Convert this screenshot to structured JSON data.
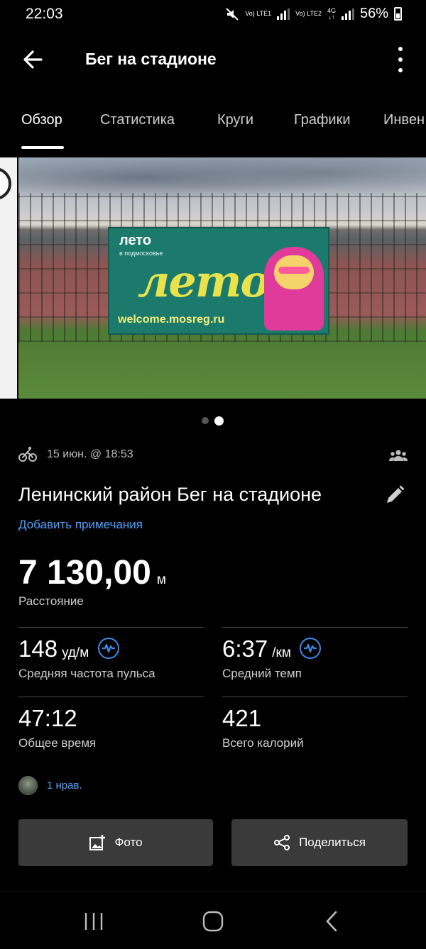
{
  "status_bar": {
    "time": "22:03",
    "network1": "Vo) LTE1",
    "network2": "Vo) LTE2",
    "network_gen": "4G",
    "battery_percent": "56%"
  },
  "app_bar": {
    "title": "Бег на стадионе"
  },
  "tabs": [
    {
      "label": "Обзор",
      "active": true
    },
    {
      "label": "Статистика",
      "active": false
    },
    {
      "label": "Круги",
      "active": false
    },
    {
      "label": "Графики",
      "active": false
    },
    {
      "label": "Инвен",
      "active": false
    }
  ],
  "photo": {
    "banner_title": "лето",
    "banner_subtitle": "в подмосковье",
    "banner_script": "лето",
    "banner_url": "welcome.mosreg.ru",
    "page_count": 2,
    "active_page": 2
  },
  "activity": {
    "date": "15 июн. @ 18:53",
    "name": "Ленинский район Бег на стадионе",
    "add_note": "Добавить примечания",
    "distance_value": "7 130,00",
    "distance_unit": "м",
    "distance_label": "Расстояние"
  },
  "stats": {
    "hr": {
      "value": "148",
      "unit": "уд/м",
      "label": "Средняя частота пульса"
    },
    "pace": {
      "value": "6:37",
      "unit": "/км",
      "label": "Средний темп"
    },
    "time": {
      "value": "47:12",
      "label": "Общее время"
    },
    "calories": {
      "value": "421",
      "label": "Всего калорий"
    }
  },
  "likes": {
    "text": "1 нрав."
  },
  "buttons": {
    "photo": "Фото",
    "share": "Поделиться"
  },
  "colors": {
    "accent": "#4ea3ff",
    "button_bg": "#3a3a3a",
    "background": "#000000"
  }
}
